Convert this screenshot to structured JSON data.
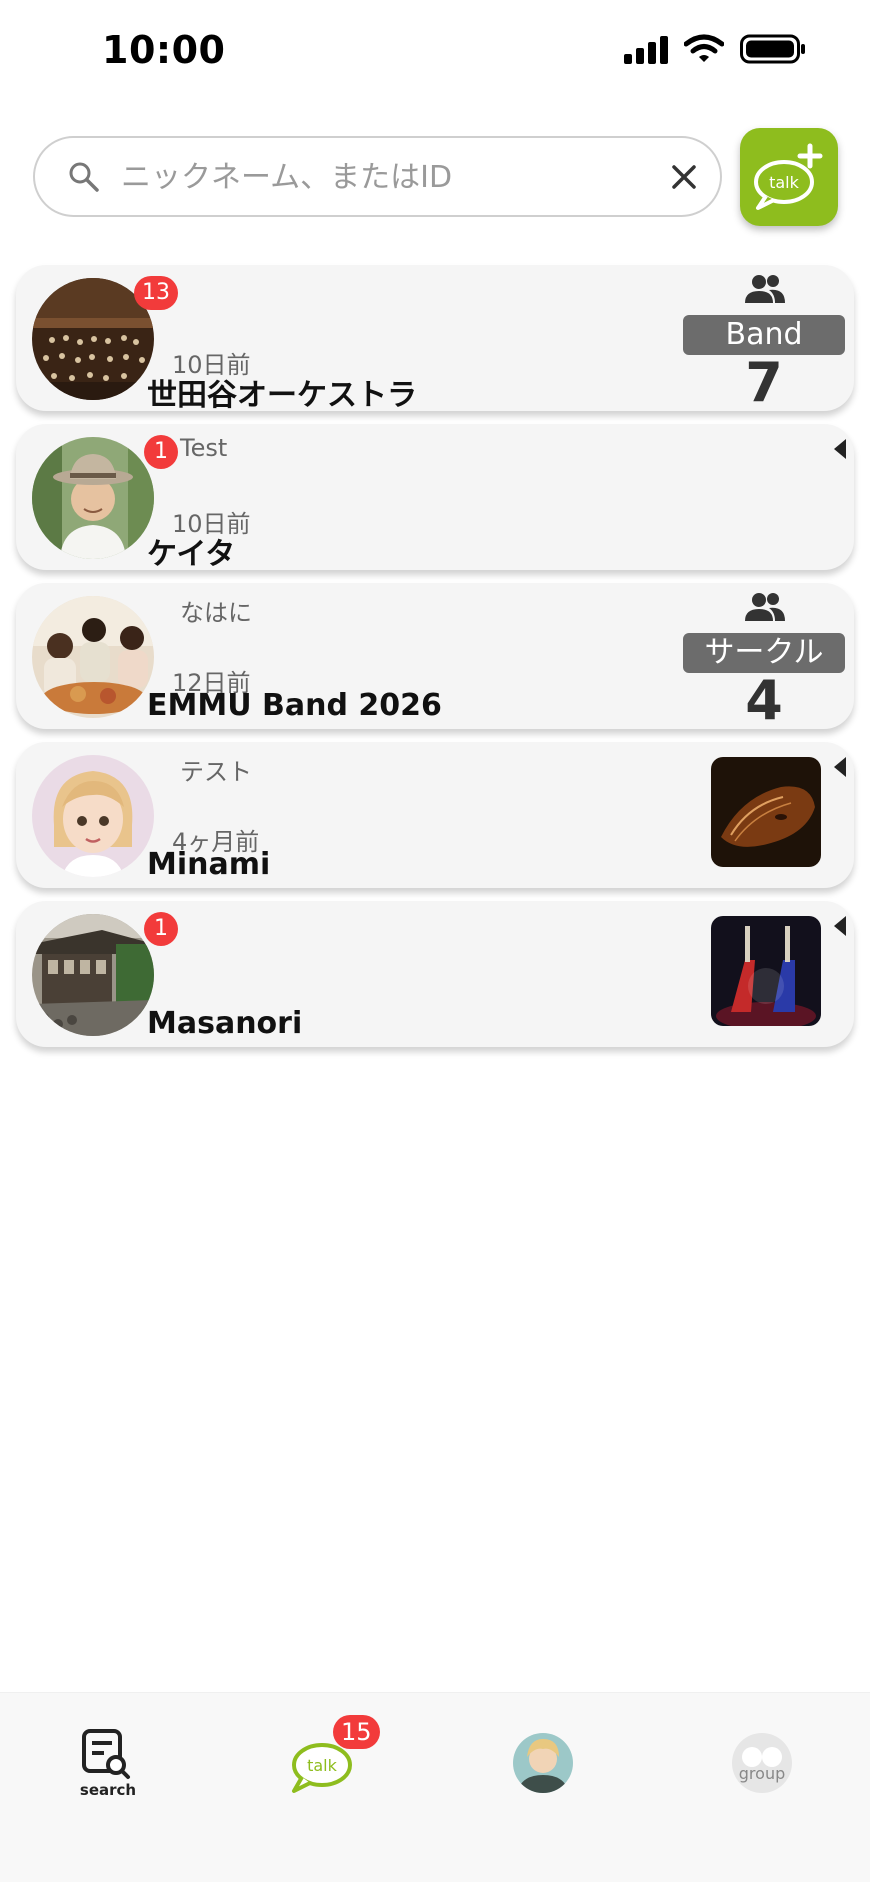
{
  "status_bar": {
    "time": "10:00"
  },
  "search": {
    "placeholder": "ニックネーム、またはID",
    "value": ""
  },
  "new_talk_button": {
    "icon": "talk-plus-icon",
    "label": "talk"
  },
  "conversations": [
    {
      "name": "世田谷オーケストラ",
      "time": "10日前",
      "message": "",
      "unread": "13",
      "group_type": "Band",
      "member_count": "7",
      "avatar": "orchestra-photo"
    },
    {
      "name": "ケイタ",
      "time": "10日前",
      "message": "Test",
      "unread": "1",
      "avatar": "man-with-hat-photo"
    },
    {
      "name": "EMMU Band 2026",
      "time": "12日前",
      "message": "なはに",
      "unread": "",
      "group_type": "サークル",
      "member_count": "4",
      "avatar": "friends-dining-photo"
    },
    {
      "name": "Minami",
      "time": "4ヶ月前",
      "message": "テスト",
      "unread": "",
      "avatar": "cartoon-girl-avatar",
      "thumbnail": "violin-photo"
    },
    {
      "name": "Masanori",
      "time": "",
      "message": "",
      "unread": "1",
      "avatar": "japanese-house-photo",
      "thumbnail": "guitars-photo"
    }
  ],
  "bottom_nav": {
    "items": [
      {
        "label": "search",
        "icon": "search-tab-icon"
      },
      {
        "label": "talk",
        "icon": "talk-tab-icon",
        "badge": "15"
      },
      {
        "label": "",
        "icon": "profile-avatar-icon"
      },
      {
        "label": "group",
        "icon": "group-tab-icon"
      }
    ]
  },
  "colors": {
    "accent": "#8ebd1e",
    "badge": "#f23b3b",
    "pill": "#6c6c6c",
    "card": "#f5f5f5"
  }
}
